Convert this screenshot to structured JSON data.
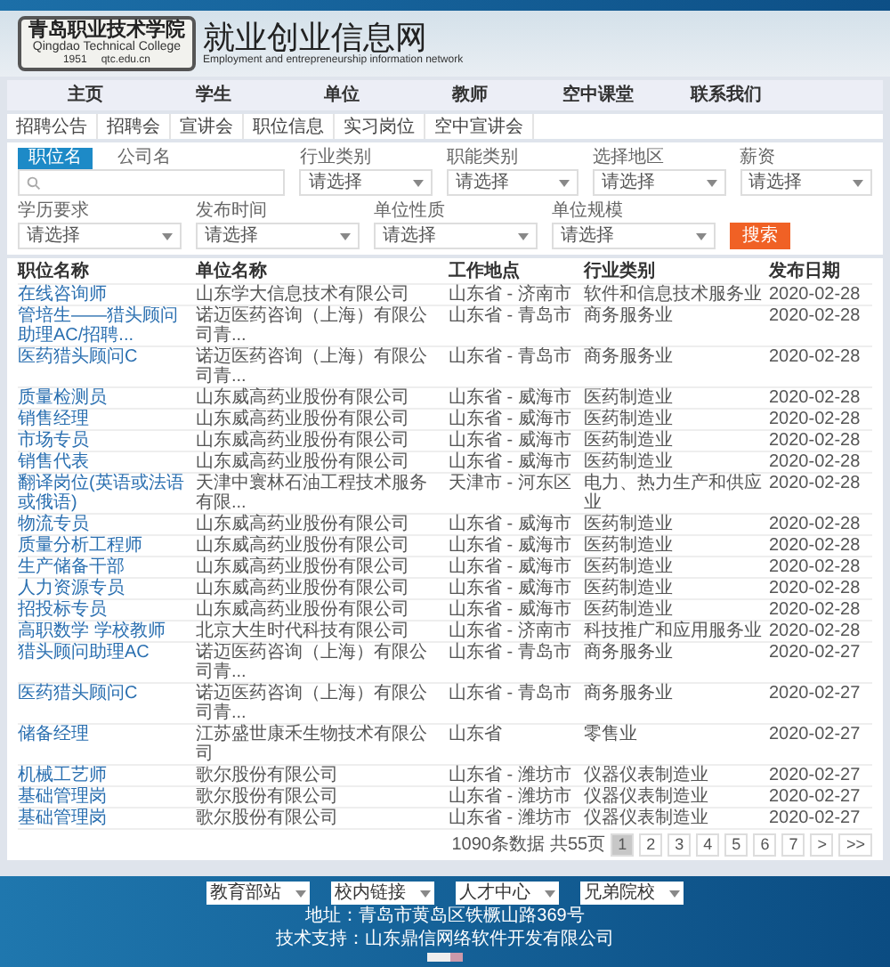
{
  "header": {
    "logo": {
      "name": "青岛职业技术学院",
      "english": "Qingdao Technical College",
      "year": "1951",
      "domain": "qtc.edu.cn"
    },
    "title": "就业创业信息网",
    "subtitle": "Employment and entrepreneurship information network"
  },
  "nav": [
    {
      "label": "主页"
    },
    {
      "label": "学生"
    },
    {
      "label": "单位"
    },
    {
      "label": "教师"
    },
    {
      "label": "空中课堂"
    },
    {
      "label": "联系我们"
    }
  ],
  "subnav": [
    {
      "label": "招聘公告"
    },
    {
      "label": "招聘会"
    },
    {
      "label": "宣讲会"
    },
    {
      "label": "职位信息"
    },
    {
      "label": "实习岗位"
    },
    {
      "label": "空中宣讲会"
    }
  ],
  "search": {
    "modes": [
      {
        "label": "职位名",
        "selected": true
      },
      {
        "label": "公司名",
        "selected": false
      }
    ],
    "filters": [
      {
        "label": "行业类别",
        "placeholder": "请选择"
      },
      {
        "label": "职能类别",
        "placeholder": "请选择"
      },
      {
        "label": "选择地区",
        "placeholder": "请选择"
      },
      {
        "label": "薪资",
        "placeholder": "请选择"
      },
      {
        "label": "学历要求",
        "placeholder": "请选择"
      },
      {
        "label": "发布时间",
        "placeholder": "请选择"
      },
      {
        "label": "单位性质",
        "placeholder": "请选择"
      },
      {
        "label": "单位规模",
        "placeholder": "请选择"
      }
    ],
    "button": "搜索"
  },
  "table": {
    "columns": [
      "职位名称",
      "单位名称",
      "工作地点",
      "行业类别",
      "发布日期"
    ],
    "rows": [
      [
        "在线咨询师",
        "山东学大信息技术有限公司",
        "山东省 - 济南市",
        "软件和信息技术服务业",
        "2020-02-28"
      ],
      [
        "管培生——猎头顾问助理AC/招聘...",
        "诺迈医药咨询（上海）有限公司青...",
        "山东省 - 青岛市",
        "商务服务业",
        "2020-02-28"
      ],
      [
        "医药猎头顾问C",
        "诺迈医药咨询（上海）有限公司青...",
        "山东省 - 青岛市",
        "商务服务业",
        "2020-02-28"
      ],
      [
        "质量检测员",
        "山东威高药业股份有限公司",
        "山东省 - 威海市",
        "医药制造业",
        "2020-02-28"
      ],
      [
        "销售经理",
        "山东威高药业股份有限公司",
        "山东省 - 威海市",
        "医药制造业",
        "2020-02-28"
      ],
      [
        "市场专员",
        "山东威高药业股份有限公司",
        "山东省 - 威海市",
        "医药制造业",
        "2020-02-28"
      ],
      [
        "销售代表",
        "山东威高药业股份有限公司",
        "山东省 - 威海市",
        "医药制造业",
        "2020-02-28"
      ],
      [
        "翻译岗位(英语或法语或俄语)",
        "天津中寰林石油工程技术服务有限...",
        "天津市 - 河东区",
        "电力、热力生产和供应业",
        "2020-02-28"
      ],
      [
        "物流专员",
        "山东威高药业股份有限公司",
        "山东省 - 威海市",
        "医药制造业",
        "2020-02-28"
      ],
      [
        "质量分析工程师",
        "山东威高药业股份有限公司",
        "山东省 - 威海市",
        "医药制造业",
        "2020-02-28"
      ],
      [
        "生产储备干部",
        "山东威高药业股份有限公司",
        "山东省 - 威海市",
        "医药制造业",
        "2020-02-28"
      ],
      [
        "人力资源专员",
        "山东威高药业股份有限公司",
        "山东省 - 威海市",
        "医药制造业",
        "2020-02-28"
      ],
      [
        "招投标专员",
        "山东威高药业股份有限公司",
        "山东省 - 威海市",
        "医药制造业",
        "2020-02-28"
      ],
      [
        "高职数学 学校教师",
        "北京大生时代科技有限公司",
        "山东省 - 济南市",
        "科技推广和应用服务业",
        "2020-02-28"
      ],
      [
        "猎头顾问助理AC",
        "诺迈医药咨询（上海）有限公司青...",
        "山东省 - 青岛市",
        "商务服务业",
        "2020-02-27"
      ],
      [
        "医药猎头顾问C",
        "诺迈医药咨询（上海）有限公司青...",
        "山东省 - 青岛市",
        "商务服务业",
        "2020-02-27"
      ],
      [
        "储备经理",
        "江苏盛世康禾生物技术有限公司",
        "山东省",
        "零售业",
        "2020-02-27"
      ],
      [
        "机械工艺师",
        "歌尔股份有限公司",
        "山东省 - 潍坊市",
        "仪器仪表制造业",
        "2020-02-27"
      ],
      [
        "基础管理岗",
        "歌尔股份有限公司",
        "山东省 - 潍坊市",
        "仪器仪表制造业",
        "2020-02-27"
      ],
      [
        "基础管理岗",
        "歌尔股份有限公司",
        "山东省 - 潍坊市",
        "仪器仪表制造业",
        "2020-02-27"
      ]
    ]
  },
  "pagination": {
    "total": "1090条数据",
    "pages": "共55页",
    "items": [
      {
        "label": "1",
        "selected": true
      },
      {
        "label": "2",
        "selected": false
      },
      {
        "label": "3",
        "selected": false
      },
      {
        "label": "4",
        "selected": false
      },
      {
        "label": "5",
        "selected": false
      },
      {
        "label": "6",
        "selected": false
      },
      {
        "label": "7",
        "selected": false
      },
      {
        "label": ">",
        "selected": false
      },
      {
        "label": ">>",
        "selected": false
      }
    ]
  },
  "footer": {
    "links": [
      "教育部站",
      "校内链接",
      "人才中心",
      "兄弟院校"
    ],
    "address": "地址：青岛市黄岛区铁橛山路369号",
    "support": "技术支持：山东鼎信网络软件开发有限公司"
  }
}
